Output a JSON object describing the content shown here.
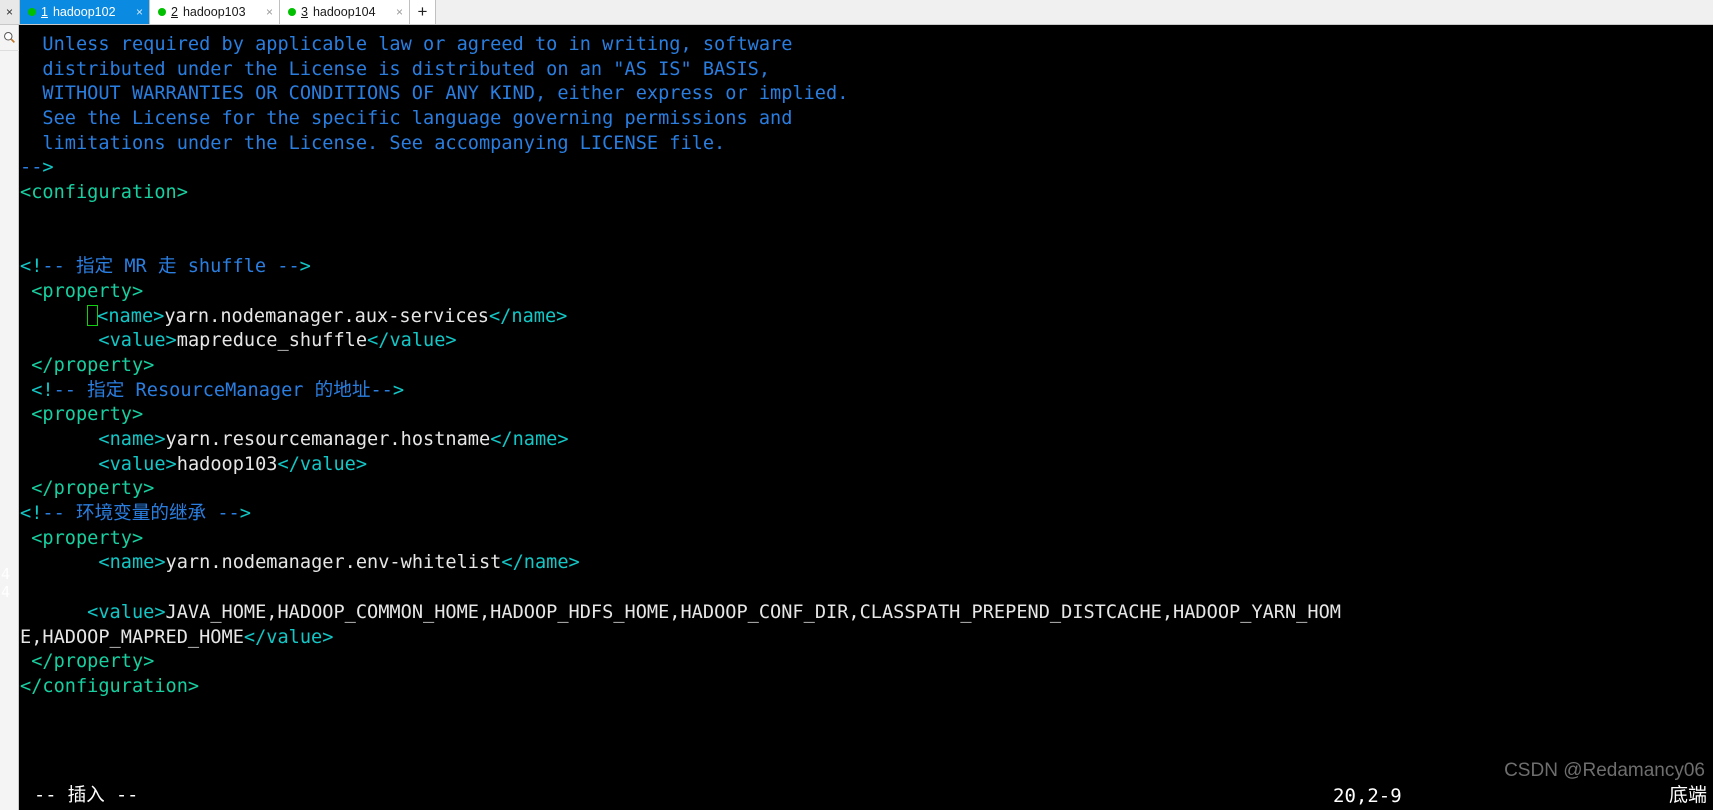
{
  "window": {
    "close_all_glyph": "×",
    "add_tab_glyph": "+"
  },
  "tabs": [
    {
      "index": "1",
      "label": "hadoop102",
      "status_dot": "#00c000",
      "close_glyph": "×",
      "active": true
    },
    {
      "index": "2",
      "label": "hadoop103",
      "status_dot": "#00c000",
      "close_glyph": "×",
      "active": false
    },
    {
      "index": "3",
      "label": "hadoop104",
      "status_dot": "#00c000",
      "close_glyph": "×",
      "active": false
    }
  ],
  "sidebar": {
    "icons": [
      {
        "name": "search-icon",
        "glyph": "🔍"
      }
    ]
  },
  "gutter": {
    "line_a": "4",
    "line_b": "4"
  },
  "editor": {
    "filetype": "xml",
    "colors": {
      "comment": "#2a7ee0",
      "tag": "#13c7c7",
      "close_tag": "#17cfa0",
      "text": "#e6e6e6",
      "cursor": "#10d010",
      "background": "#000000"
    },
    "lines": [
      {
        "indent": "  ",
        "segments": [
          {
            "cls": "c-comment",
            "t": "Unless required by applicable law or agreed to in writing, software"
          }
        ]
      },
      {
        "indent": "  ",
        "segments": [
          {
            "cls": "c-comment",
            "t": "distributed under the License is distributed on an \"AS IS\" BASIS,"
          }
        ]
      },
      {
        "indent": "  ",
        "segments": [
          {
            "cls": "c-comment",
            "t": "WITHOUT WARRANTIES OR CONDITIONS OF ANY KIND, either express or implied."
          }
        ]
      },
      {
        "indent": "  ",
        "segments": [
          {
            "cls": "c-comment",
            "t": "See the License for the specific language governing permissions and"
          }
        ]
      },
      {
        "indent": "  ",
        "segments": [
          {
            "cls": "c-comment",
            "t": "limitations under the License. See accompanying LICENSE file."
          }
        ]
      },
      {
        "indent": "",
        "segments": [
          {
            "cls": "c-comment",
            "t": "--"
          },
          {
            "cls": "c-tag",
            "t": ">"
          }
        ]
      },
      {
        "indent": "",
        "segments": [
          {
            "cls": "c-tag2",
            "t": "<configuration>"
          }
        ]
      },
      {
        "indent": "",
        "segments": []
      },
      {
        "indent": "",
        "segments": []
      },
      {
        "indent": "",
        "segments": [
          {
            "cls": "c-tag",
            "t": "<!"
          },
          {
            "cls": "c-comment",
            "t": "-- 指定 MR 走 shuffle --"
          },
          {
            "cls": "c-tag",
            "t": ">"
          }
        ]
      },
      {
        "indent": " ",
        "segments": [
          {
            "cls": "c-tag2",
            "t": "<property>"
          }
        ]
      },
      {
        "indent": "      ",
        "segments": [
          {
            "cls": "cursor"
          },
          {
            "cls": "c-tag",
            "t": "<name>"
          },
          {
            "cls": "c-text",
            "t": "yarn.nodemanager.aux-services"
          },
          {
            "cls": "c-tag",
            "t": "</name>"
          }
        ]
      },
      {
        "indent": "       ",
        "segments": [
          {
            "cls": "c-tag",
            "t": "<value>"
          },
          {
            "cls": "c-text",
            "t": "mapreduce_shuffle"
          },
          {
            "cls": "c-tag",
            "t": "</value>"
          }
        ]
      },
      {
        "indent": " ",
        "segments": [
          {
            "cls": "c-tag2",
            "t": "</property>"
          }
        ]
      },
      {
        "indent": " ",
        "segments": [
          {
            "cls": "c-tag",
            "t": "<!"
          },
          {
            "cls": "c-comment",
            "t": "-- 指定 ResourceManager 的地址--"
          },
          {
            "cls": "c-tag",
            "t": ">"
          }
        ]
      },
      {
        "indent": " ",
        "segments": [
          {
            "cls": "c-tag2",
            "t": "<property>"
          }
        ]
      },
      {
        "indent": "       ",
        "segments": [
          {
            "cls": "c-tag",
            "t": "<name>"
          },
          {
            "cls": "c-text",
            "t": "yarn.resourcemanager.hostname"
          },
          {
            "cls": "c-tag",
            "t": "</name>"
          }
        ]
      },
      {
        "indent": "       ",
        "segments": [
          {
            "cls": "c-tag",
            "t": "<value>"
          },
          {
            "cls": "c-text",
            "t": "hadoop103"
          },
          {
            "cls": "c-tag",
            "t": "</value>"
          }
        ]
      },
      {
        "indent": " ",
        "segments": [
          {
            "cls": "c-tag2",
            "t": "</property>"
          }
        ]
      },
      {
        "indent": "",
        "segments": [
          {
            "cls": "c-tag",
            "t": "<!"
          },
          {
            "cls": "c-comment",
            "t": "-- 环境变量的继承 --"
          },
          {
            "cls": "c-tag",
            "t": ">"
          }
        ]
      },
      {
        "indent": " ",
        "segments": [
          {
            "cls": "c-tag2",
            "t": "<property>"
          }
        ]
      },
      {
        "indent": "       ",
        "segments": [
          {
            "cls": "c-tag",
            "t": "<name>"
          },
          {
            "cls": "c-text",
            "t": "yarn.nodemanager.env-whitelist"
          },
          {
            "cls": "c-tag",
            "t": "</name>"
          }
        ]
      },
      {
        "indent": "",
        "segments": []
      },
      {
        "indent": "      ",
        "segments": [
          {
            "cls": "c-tag",
            "t": "<value>"
          },
          {
            "cls": "c-text",
            "t": "JAVA_HOME,HADOOP_COMMON_HOME,HADOOP_HDFS_HOME,HADOOP_CONF_DIR,CLASSPATH_PREPEND_DISTCACHE,HADOOP_YARN_HOM"
          }
        ]
      },
      {
        "indent": "",
        "segments": [
          {
            "cls": "c-text",
            "t": "E,HADOOP_MAPRED_HOME"
          },
          {
            "cls": "c-tag",
            "t": "</value>"
          }
        ]
      },
      {
        "indent": " ",
        "segments": [
          {
            "cls": "c-tag2",
            "t": "</property>"
          }
        ]
      },
      {
        "indent": "",
        "segments": [
          {
            "cls": "c-tag2",
            "t": "</configuration>"
          }
        ]
      }
    ]
  },
  "status": {
    "mode": "-- 插入 --",
    "ruler": "20,2-9",
    "position": "底端"
  },
  "watermark": {
    "text": "CSDN @Redamancy06"
  }
}
